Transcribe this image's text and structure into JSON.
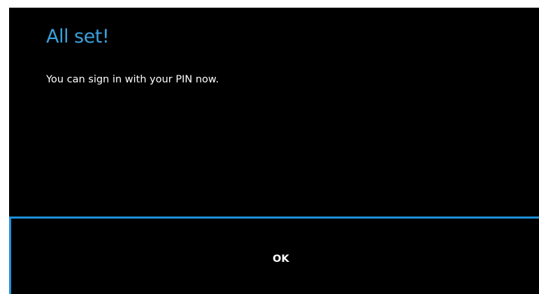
{
  "dialog": {
    "title": "All set!",
    "message": "You can sign in with your PIN now.",
    "ok_label": "OK"
  },
  "colors": {
    "accent": "#3aa0dc",
    "button_border": "#1e90d8",
    "background": "#000000",
    "text": "#ffffff"
  }
}
